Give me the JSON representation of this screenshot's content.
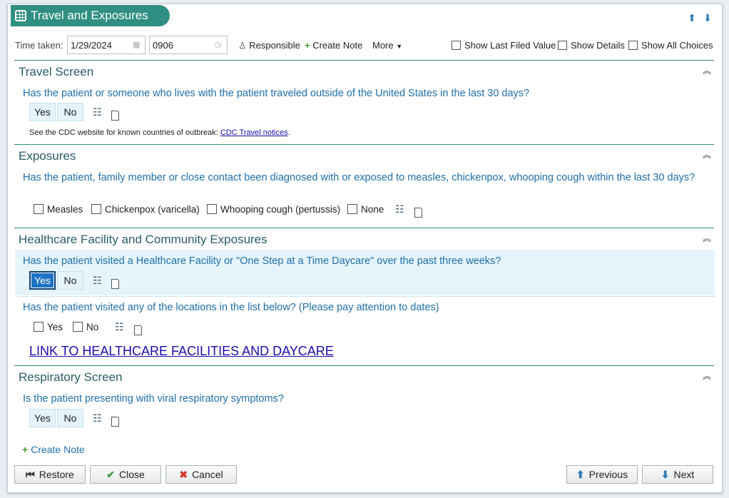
{
  "window": {
    "title": "Travel and Exposures",
    "icons": {
      "title": "table-icon",
      "move_up": "arrow-up-icon",
      "move_down": "arrow-down-icon"
    }
  },
  "toolbar": {
    "time_taken_label": "Time taken:",
    "date_value": "1/29/2024",
    "time_value": "0906",
    "responsible_label": "Responsible",
    "create_note_label": "Create Note",
    "more_label": "More",
    "show_last_filed_label": "Show Last Filed Value",
    "show_details_label": "Show Details",
    "show_all_choices_label": "Show All Choices"
  },
  "sections": {
    "travel": {
      "title": "Travel Screen",
      "question": "Has the patient or someone who lives with the patient traveled outside of the United States in the last 30 days?",
      "yes": "Yes",
      "no": "No",
      "note_text": "See the CDC website for known countries of outbreak: ",
      "note_link": "CDC Travel notices",
      "note_end": "."
    },
    "exposures": {
      "title": "Exposures",
      "question": "Has the patient, family member or close contact been diagnosed with or exposed to measles, chickenpox, whooping cough within the last 30 days?",
      "options": [
        "Measles",
        "Chickenpox (varicella)",
        "Whooping cough (pertussis)",
        "None"
      ]
    },
    "healthcare": {
      "title": "Healthcare Facility and Community Exposures",
      "question1": "Has the patient visited a Healthcare Facility or \"One Step at a Time Daycare\" over the past three weeks?",
      "q1_yes": "Yes",
      "q1_no": "No",
      "q1_selected": "Yes",
      "question2": "Has the patient visited any of the locations in the list below? (Please pay attention to dates)",
      "q2_yes": "Yes",
      "q2_no": "No",
      "link": "LINK TO HEALTHCARE FACILITIES AND DAYCARE"
    },
    "respiratory": {
      "title": "Respiratory Screen",
      "question": "Is the patient presenting with viral respiratory symptoms?",
      "yes": "Yes",
      "no": "No"
    }
  },
  "footer": {
    "create_note_label": "Create Note",
    "restore_label": "Restore",
    "close_label": "Close",
    "cancel_label": "Cancel",
    "previous_label": "Previous",
    "next_label": "Next"
  },
  "colors": {
    "accent": "#2f8f82",
    "question": "#1f6fa8",
    "selected": "#1d74c4",
    "highlight": "#e6f4fb"
  }
}
